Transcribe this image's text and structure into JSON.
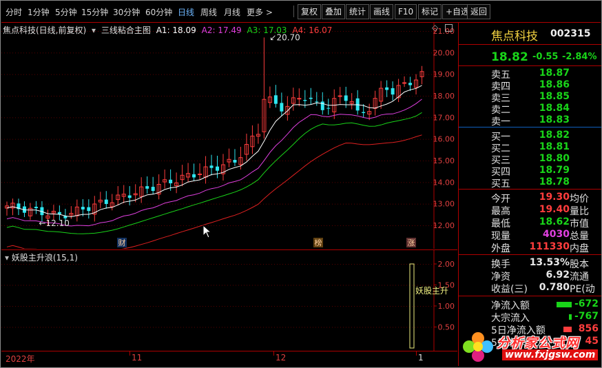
{
  "toolbar": {
    "periods": [
      "分时",
      "1分钟",
      "5分钟",
      "15分钟",
      "30分钟",
      "60分钟",
      "日线",
      "周线",
      "月线",
      "更多 >"
    ],
    "active_period": "日线",
    "buttons": [
      "复权",
      "叠加",
      "统计",
      "画线",
      "F10",
      "标记",
      "+自选",
      "返回"
    ]
  },
  "main_chart": {
    "stock_title": "焦点科技(日线,前复权)",
    "indicator": "三线粘合主图",
    "a1": "A1: 18.09",
    "a2": "A2: 17.49",
    "a3": "A3: 17.03",
    "a4": "A4: 16.07",
    "high_marker": "20.70",
    "low_marker": "12.10",
    "event_marks": [
      "财",
      "榜",
      "涨"
    ],
    "y_ticks": [
      "21.00",
      "20.00",
      "19.00",
      "18.00",
      "17.00",
      "16.00",
      "15.00",
      "14.00",
      "13.00",
      "12.00"
    ]
  },
  "sub_chart": {
    "title": "妖股主升浪(15,1)",
    "signal_label": "妖股主升",
    "y_ticks": [
      "2.00",
      "1.50",
      "1.00",
      "0.50"
    ]
  },
  "x_axis": {
    "labels": [
      "2022年",
      "11",
      "12",
      "1"
    ]
  },
  "quote": {
    "name": "焦点科技",
    "code": "002315",
    "price": "18.82",
    "change": "-0.55",
    "change_pct": "-2.84%",
    "asks": [
      {
        "label": "卖五",
        "price": "18.87"
      },
      {
        "label": "卖四",
        "price": "18.86"
      },
      {
        "label": "卖三",
        "price": "18.85"
      },
      {
        "label": "卖二",
        "price": "18.84"
      },
      {
        "label": "卖一",
        "price": "18.83"
      }
    ],
    "bids": [
      {
        "label": "买一",
        "price": "18.82"
      },
      {
        "label": "买二",
        "price": "18.81"
      },
      {
        "label": "买三",
        "price": "18.80"
      },
      {
        "label": "买四",
        "price": "18.79"
      },
      {
        "label": "买五",
        "price": "18.78"
      }
    ],
    "stats": [
      {
        "label": "今开",
        "value": "19.30",
        "label2": "均价"
      },
      {
        "label": "最高",
        "value": "19.40",
        "label2": "量比"
      },
      {
        "label": "最低",
        "value": "18.62",
        "label2": "市值"
      },
      {
        "label": "现量",
        "value": "4030",
        "label2": "总量"
      },
      {
        "label": "外盘",
        "value": "111330",
        "label2": "内盘"
      }
    ],
    "stats2": [
      {
        "label": "换手",
        "value": "13.53%",
        "label2": "股本"
      },
      {
        "label": "净资",
        "value": "6.92",
        "label2": "流通"
      },
      {
        "label": "收益(三)",
        "value": "0.780",
        "label2": "PE(动"
      }
    ],
    "flows": [
      {
        "label": "净流入额",
        "value": "-672"
      },
      {
        "label": "大宗流入",
        "value": "-767"
      },
      {
        "label": "5日净流入额",
        "value": "856"
      },
      {
        "label": "5日大宗流入",
        "value": "45"
      }
    ]
  },
  "watermark": {
    "title": "分析家公式网",
    "url": "www.fxjgsw.com"
  },
  "colors": {
    "up": "#ff3d3d",
    "down": "#19d419",
    "cyan_candle": "#2ee6f0",
    "ma_white": "#ffffff",
    "ma_magenta": "#e040e0",
    "ma_green": "#19d419",
    "ma_red": "#e02020"
  }
}
